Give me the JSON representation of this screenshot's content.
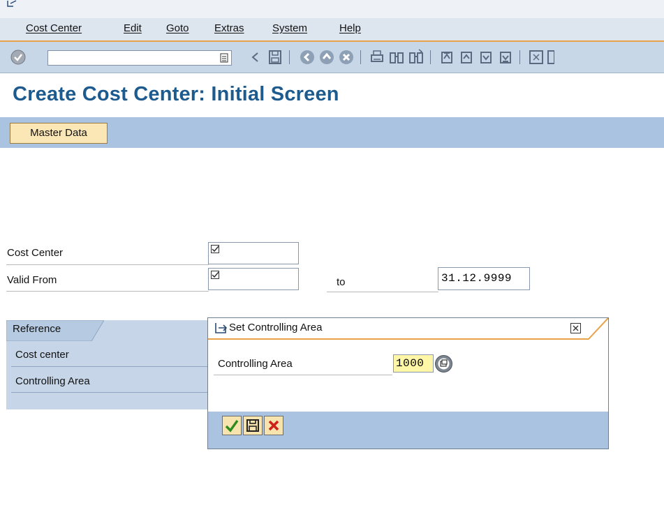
{
  "menubar": {
    "items": [
      "Cost Center",
      "Edit",
      "Goto",
      "Extras",
      "System",
      "Help"
    ]
  },
  "toolbar": {
    "command_field_value": "",
    "icons": [
      "enter-icon",
      "save-icon",
      "back-icon",
      "exit-icon",
      "cancel-icon",
      "print-icon",
      "find-icon",
      "find-next-icon",
      "first-page-icon",
      "prev-page-icon",
      "next-page-icon",
      "last-page-icon",
      "create-session-icon"
    ]
  },
  "page": {
    "title": "Create Cost Center: Initial Screen"
  },
  "app_toolbar": {
    "master_data_label": "Master Data"
  },
  "form": {
    "cost_center_label": "Cost Center",
    "valid_from_label": "Valid From",
    "to_label": "to",
    "to_value": "31.12.9999"
  },
  "reference": {
    "tab_label": "Reference",
    "fields": [
      "Cost center",
      "Controlling Area"
    ]
  },
  "dialog": {
    "title": "Set Controlling Area",
    "field_label": "Controlling Area",
    "field_value": "1000"
  },
  "colors": {
    "title_blue": "#1d5b8f",
    "menu_accent": "#e8a24a",
    "toolbar_bg": "#c8d7e8",
    "app_toolbar_bg": "#a9c3e1",
    "button_bg": "#fbe7b5",
    "highlight_input": "#fff6a8"
  }
}
